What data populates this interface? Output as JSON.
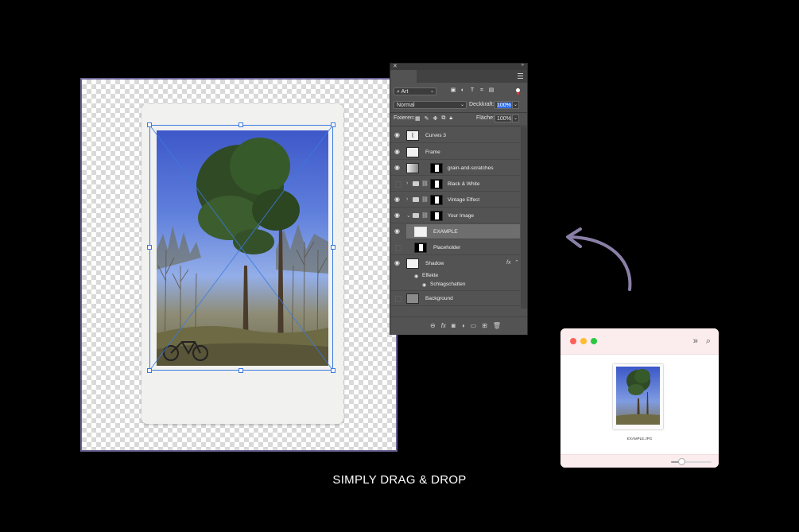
{
  "caption": "SIMPLY DRAG & DROP",
  "layers_panel": {
    "filter_kind": "Art",
    "blend_mode": "Normal",
    "opacity_label": "Deckkraft:",
    "opacity_value": "100%",
    "lock_label": "Fixieren:",
    "fill_label": "Fläche:",
    "fill_value": "100%",
    "layers": [
      {
        "name": "Curves 3",
        "visible": true
      },
      {
        "name": "Frame",
        "visible": true
      },
      {
        "name": "grain-and-scratches",
        "visible": true
      },
      {
        "name": "Black & White",
        "visible": false
      },
      {
        "name": "Vintage Effect",
        "visible": true
      },
      {
        "name": "Your Image",
        "visible": true
      },
      {
        "name": "EXAMPLE",
        "visible": true,
        "selected": true
      },
      {
        "name": "Placeholder",
        "visible": false
      },
      {
        "name": "Shadow",
        "visible": true
      },
      {
        "name": "Background",
        "visible": false
      }
    ],
    "effects_label": "Effekte",
    "effect_name": "Schlagschatten"
  },
  "finder": {
    "file_name": "EXAMPLE.JPG",
    "traffic_colors": {
      "close": "#fe5f57",
      "minimize": "#febc2e",
      "zoom": "#28c840"
    }
  },
  "colors": {
    "canvas_border": "#6b6393",
    "transform_box": "#3a7be0",
    "panel_bg": "#535353",
    "arrow": "#8a7fa6"
  }
}
